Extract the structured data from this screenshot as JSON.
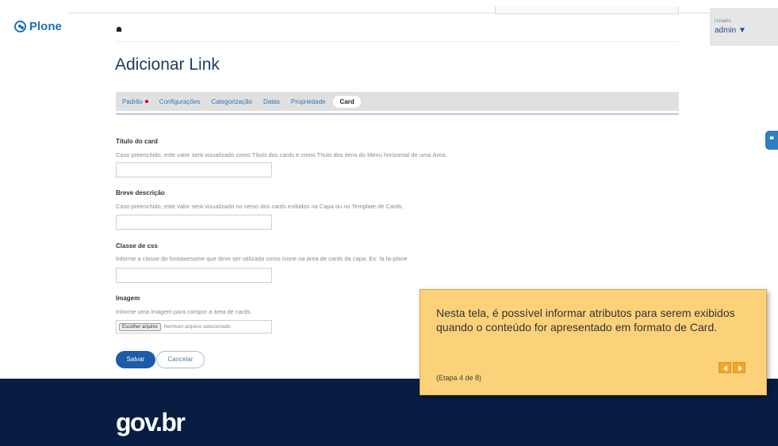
{
  "brand": {
    "logo": "Plone",
    "footer_logo": "gov.br"
  },
  "user": {
    "label": "Usuário",
    "name": "admin ▼"
  },
  "side_button": {
    "icon": "chat-bubble-icon"
  },
  "breadcrumb": {
    "home_icon": "home-icon"
  },
  "page": {
    "title": "Adicionar Link"
  },
  "tabs": [
    {
      "label": "Padrão",
      "required": true
    },
    {
      "label": "Configurações"
    },
    {
      "label": "Categorização"
    },
    {
      "label": "Datas"
    },
    {
      "label": "Propriedade"
    },
    {
      "label": "Card",
      "active": true
    }
  ],
  "form": {
    "card_title": {
      "label": "Título do card",
      "help": "Caso preenchido, este valor será visualizado como Título dos cards e como Título dos itens do Menu horizontal de uma Área.",
      "value": ""
    },
    "description": {
      "label": "Breve descrição",
      "help": "Caso preenchido, este valor será visualizado no verso dos cards exibidos na Capa ou no Template de Cards.",
      "value": ""
    },
    "css_class": {
      "label": "Classe de css",
      "help": "Informe a classe do fontawesome que deve ser utilizada como ícone na área de cards da capa. Ex: fa fa-plane",
      "value": ""
    },
    "image": {
      "label": "Imagem",
      "help": "Informe uma imagem para compor a área de cards.",
      "button": "Escolher arquivo",
      "status": "Nenhum arquivo selecionado"
    },
    "save_label": "Salvar",
    "cancel_label": "Cancelar"
  },
  "tour": {
    "text": "Nesta tela, é possível informar atributos para serem exibidos quando o conteúdo for apresentado em formato de Card.",
    "step": "(Etapa 4 de 8)"
  },
  "colors": {
    "accent": "#1c5ca8",
    "footer": "#071d41",
    "tooltip": "#fbd27a",
    "required": "#d0021b"
  }
}
